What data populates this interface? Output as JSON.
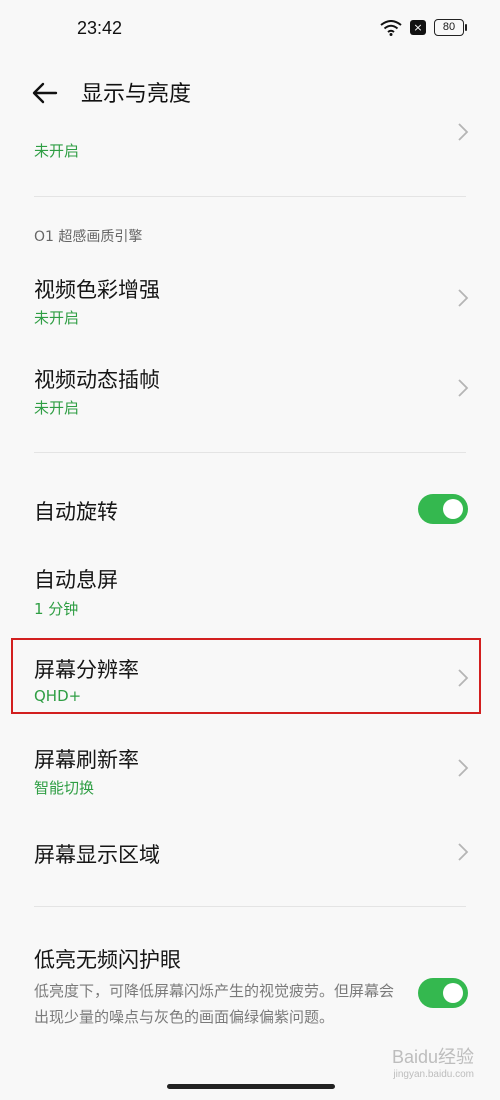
{
  "status_bar": {
    "time": "23:42",
    "battery": "80",
    "notification_badge": "×"
  },
  "header": {
    "title": "显示与亮度"
  },
  "rows": {
    "partial": {
      "sublabel": "未开启"
    },
    "video_color": {
      "label": "视频色彩增强",
      "sublabel": "未开启"
    },
    "video_frame": {
      "label": "视频动态插帧",
      "sublabel": "未开启"
    },
    "auto_rotate": {
      "label": "自动旋转",
      "toggle": "on"
    },
    "auto_sleep": {
      "label": "自动息屏",
      "sublabel": "1 分钟"
    },
    "resolution": {
      "label": "屏幕分辨率",
      "sublabel": "QHD+"
    },
    "refresh_rate": {
      "label": "屏幕刷新率",
      "sublabel": "智能切换"
    },
    "display_area": {
      "label": "屏幕显示区域"
    },
    "low_brightness": {
      "label": "低亮无频闪护眼",
      "description": "低亮度下，可降低屏幕闪烁产生的视觉疲劳。但屏幕会出现少量的噪点与灰色的画面偏绿偏紫问题。",
      "toggle": "on"
    }
  },
  "section": {
    "o1_title": "O1 超感画质引擎"
  },
  "watermark": {
    "text": "Baidu经验",
    "sub": "jingyan.baidu.com"
  },
  "colors": {
    "accent_green": "#34b84f",
    "sublabel_green": "#2f9e44",
    "highlight_red": "#d21f1f"
  }
}
